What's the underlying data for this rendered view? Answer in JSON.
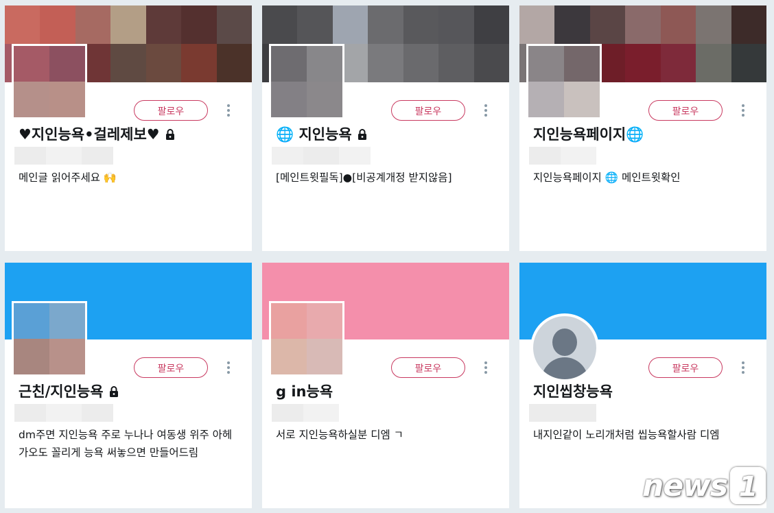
{
  "cards": [
    {
      "name": "♥지인능욕•걸레제보♥",
      "bio": "메인글 읽어주세요 🙌",
      "follow_label": "팔로우",
      "banner_type": "mosaic",
      "banner_colors": [
        "#c96a60",
        "#c35f56",
        "#a66a62",
        "#b39e86",
        "#5e3a39",
        "#54302f",
        "#5b4a48",
        "#a55a66",
        "#8c5060",
        "#6f3536",
        "#5f4a42",
        "#6b4a3f",
        "#7a3a30",
        "#4b3229"
      ],
      "avatar_colors": [
        "#a55a66",
        "#8c5060",
        "#b5908a",
        "#b89088"
      ],
      "handle_colors": [
        "#ececec",
        "#f2f2f2",
        "#ececec"
      ],
      "locked": true,
      "globe": false
    },
    {
      "name": "🌐 지인능욕",
      "bio": "[메인트윗필독]●[비공계개정 받지않음]",
      "follow_label": "팔로우",
      "banner_type": "mosaic",
      "banner_colors": [
        "#4a4a4d",
        "#555558",
        "#9ea5b0",
        "#6b6b6e",
        "#59595c",
        "#56565a",
        "#3f3f43",
        "#3d3d40",
        "#6a6a6d",
        "#a3a5a8",
        "#7a7a7d",
        "#6a6a6d",
        "#5e5e61",
        "#4a4a4d"
      ],
      "avatar_colors": [
        "#6e6c70",
        "#88878a",
        "#838085",
        "#8b888b"
      ],
      "handle_colors": [
        "#f0f0f0",
        "#ececec",
        "#f2f2f2"
      ],
      "locked": true,
      "globe": true
    },
    {
      "name": "지인능욕페이지🌐",
      "bio": "지인능욕페이지 🌐 메인트윗확인",
      "follow_label": "팔로우",
      "banner_type": "mosaic",
      "banner_colors": [
        "#b3a7a5",
        "#3c383d",
        "#5a4545",
        "#8a6a6a",
        "#8e5855",
        "#7b7471",
        "#3d2b29",
        "#7a7475",
        "#6a6666",
        "#6e1e28",
        "#7a1e2c",
        "#7e2a3a",
        "#6b6c66",
        "#35393a"
      ],
      "avatar_colors": [
        "#8a8588",
        "#74676a",
        "#b5b0b4",
        "#c9c1be"
      ],
      "handle_colors": [
        "#ececec",
        "#f2f2f2",
        "#ffffff"
      ],
      "locked": false,
      "globe": false
    },
    {
      "name": "근친/지인능욕",
      "bio": "dm주면 지인능욕 주로 누나나 여동생 위주 아헤가오도 꼴리게 능욕 써놓으면 만들어드림",
      "follow_label": "팔로우",
      "banner_type": "solid",
      "banner_color": "#1da1f2",
      "avatar_colors": [
        "#5aa0d6",
        "#7ba8cc",
        "#a8867f",
        "#b8918a"
      ],
      "handle_colors": [
        "#ececec",
        "#f2f2f2",
        "#ececec"
      ],
      "locked": true,
      "globe": false
    },
    {
      "name": "g in능욕",
      "bio": "서로 지인능욕하실분 디엠 ㄱ",
      "follow_label": "팔로우",
      "banner_type": "solid",
      "banner_color": "#f48fab",
      "avatar_colors": [
        "#e9a1a0",
        "#e8aaad",
        "#dcb7a9",
        "#d8bab6"
      ],
      "handle_colors": [
        "#ececec",
        "#f2f2f2",
        "#ffffff"
      ],
      "locked": false,
      "globe": false
    },
    {
      "name": "지인씹창능욕",
      "bio": "내지인같이 노리개처럼 씹능욕할사람 디엠",
      "follow_label": "팔로우",
      "banner_type": "solid",
      "banner_color": "#1da1f2",
      "avatar_colors": [],
      "handle_colors": [
        "#ececec",
        "#ececec",
        "#ffffff"
      ],
      "locked": false,
      "globe": false,
      "default_avatar": true
    }
  ],
  "watermark": {
    "text": "news",
    "number": "1"
  }
}
